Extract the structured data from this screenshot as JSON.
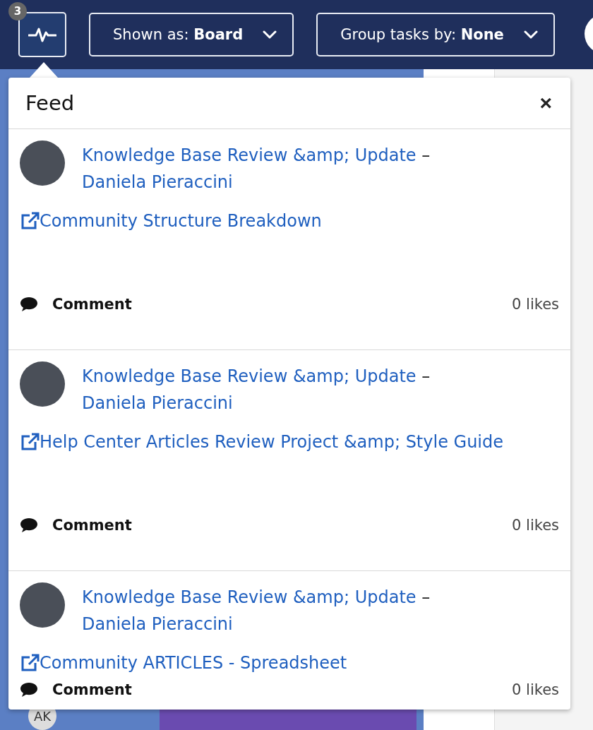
{
  "toolbar": {
    "activity_badge": "3",
    "dropdowns": [
      {
        "label": "Shown as: **Board**"
      },
      {
        "label": "Group tasks by: **None**"
      }
    ]
  },
  "feed": {
    "title": "Feed",
    "close": "×",
    "items": [
      {
        "record": "Knowledge Base Review &amp; Update",
        "separator": "–",
        "user": "Daniela Pieraccini",
        "link": "Community Structure Breakdown",
        "comment": "Comment",
        "likes": "0 likes"
      },
      {
        "record": "Knowledge Base Review &amp; Update",
        "separator": "–",
        "user": "Daniela Pieraccini",
        "link": "Help Center Articles Review Project &amp; Style Guide",
        "comment": "Comment",
        "likes": "0 likes"
      },
      {
        "record": "Knowledge Base Review &amp; Update",
        "separator": "–",
        "user": "Daniela Pieraccini",
        "link": "Community ARTICLES - Spreadsheet",
        "comment": "Comment",
        "likes": "0 likes"
      }
    ]
  },
  "board": {
    "avatar_initials": "AK"
  }
}
